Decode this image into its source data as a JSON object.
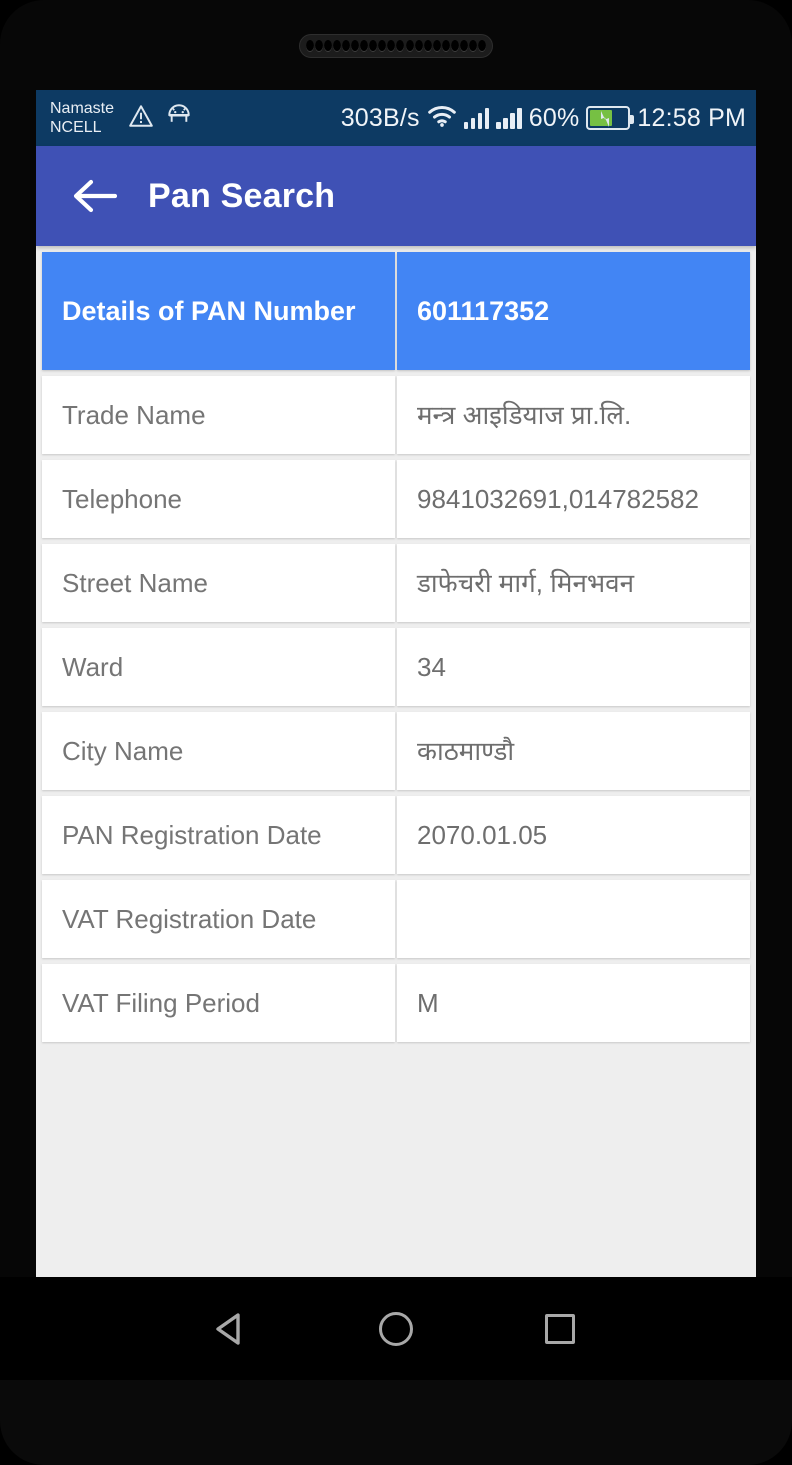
{
  "statusbar": {
    "carrier": "Namaste\nNCELL",
    "warning_icon": "warning-triangle-icon",
    "android_icon": "android-robot-icon",
    "network_speed": "303B/s",
    "wifi_icon": "wifi-icon",
    "signal_1_icon": "signal-bars-icon",
    "signal_2_icon": "signal-bars-icon",
    "battery_percent": "60%",
    "battery_level": 60,
    "battery_charging": true,
    "clock": "12:58 PM",
    "background_color": "#0D3A63"
  },
  "appbar": {
    "back_icon": "arrow-back-icon",
    "title": "Pan Search",
    "background_color": "#3F51B5"
  },
  "table": {
    "header": {
      "label": "Details of PAN Number",
      "value": "601117352",
      "background_color": "#4285F4"
    },
    "rows": [
      {
        "label": "Trade Name",
        "value": "मन्त्र आइडियाज प्रा.लि."
      },
      {
        "label": "Telephone",
        "value": "9841032691,014782582"
      },
      {
        "label": "Street Name",
        "value": "डाफेचरी मार्ग, मिनभवन"
      },
      {
        "label": "Ward",
        "value": "34"
      },
      {
        "label": "City Name",
        "value": "काठमाण्डौ"
      },
      {
        "label": "PAN Registration Date",
        "value": "2070.01.05"
      },
      {
        "label": "VAT Registration Date",
        "value": ""
      },
      {
        "label": "VAT Filing Period",
        "value": "M"
      }
    ]
  },
  "navbar": {
    "back_icon": "nav-back-triangle-icon",
    "home_icon": "nav-home-circle-icon",
    "recents_icon": "nav-recents-square-icon"
  }
}
